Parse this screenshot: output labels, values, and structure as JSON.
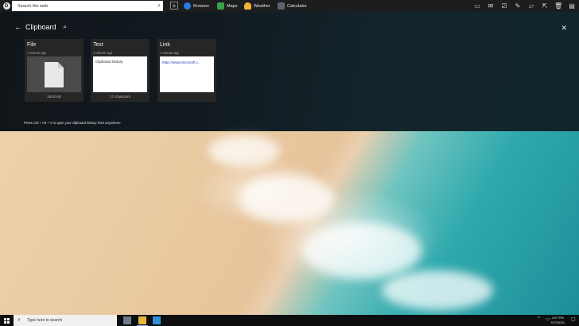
{
  "topbar": {
    "app_letter": "D",
    "search_placeholder": "Search the web",
    "new_tab": "+",
    "quick_links": [
      {
        "label": "Browser",
        "icon": "browser-icon",
        "color": "#2a7de1"
      },
      {
        "label": "Maps",
        "icon": "maps-icon",
        "color": "#3aa14a"
      },
      {
        "label": "Weather",
        "icon": "weather-icon",
        "color": "#f2b233"
      },
      {
        "label": "Calculator",
        "icon": "calculator-icon",
        "color": "#5a6470"
      }
    ]
  },
  "clipboard": {
    "title": "Clipboard",
    "items": [
      {
        "type": "File",
        "time": "1 minute ago",
        "footer": "26.63 KB"
      },
      {
        "type": "Text",
        "time": "1 minute ago",
        "preview": "Clipboard history",
        "footer": "17 characters"
      },
      {
        "type": "Link",
        "time": "1 minute ago",
        "preview": "https://www.microsoft.c..."
      }
    ],
    "hint": "Press Ctrl + Alt + V to open your clipboard history from anywhere!"
  },
  "taskbar": {
    "search_placeholder": "Type here to search",
    "time": "2:07 PM",
    "date": "7/27/2021"
  }
}
